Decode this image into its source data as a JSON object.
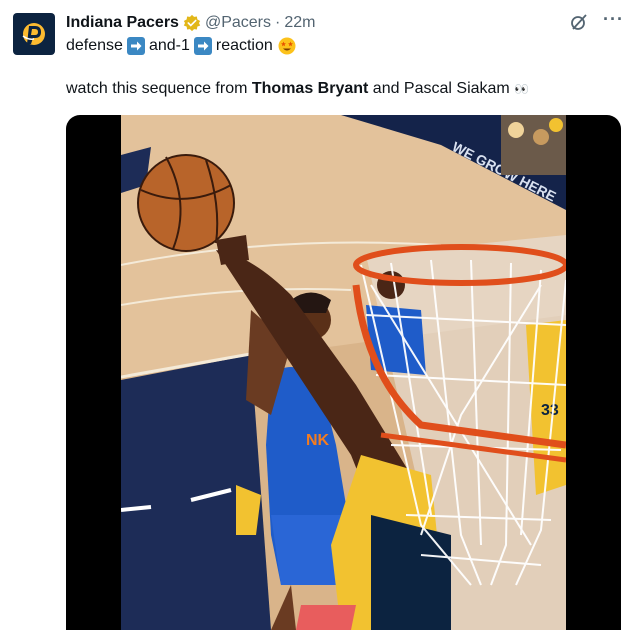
{
  "account": {
    "name": "Indiana Pacers",
    "handle": "@Pacers",
    "separator": "·",
    "time": "22m",
    "avatar_icon": "pacers-logo-icon",
    "verified_icon": "gold-verified-badge-icon",
    "brand_color": "#0c2340",
    "accent_color": "#fdbb30"
  },
  "header_actions": {
    "grok_icon": "grok-icon",
    "more_icon": "more-dots-icon",
    "more_label": "···"
  },
  "tweet": {
    "line1": {
      "word1": "defense",
      "word2": "and-1",
      "word3": "reaction",
      "arrow_icon": "right-arrow-emoji-icon",
      "reaction_icon": "star-struck-emoji-icon"
    },
    "line2": {
      "prefix": "watch this sequence from ",
      "player1": "Thomas Bryant",
      "middle": " and Pascal Siakam ",
      "eyes": "👀"
    }
  },
  "media": {
    "type": "video",
    "description_icon": "basketball-block-video",
    "banner_text": "WE GROW HERE",
    "jersey_number": "33"
  }
}
